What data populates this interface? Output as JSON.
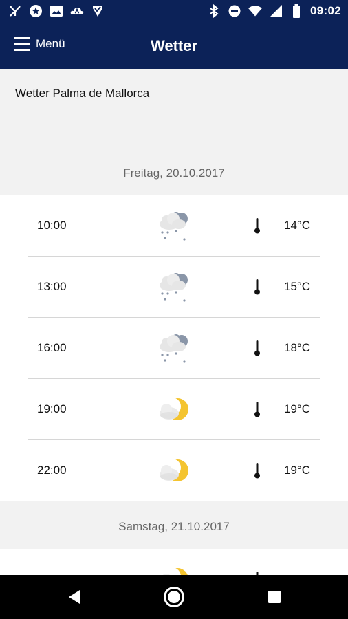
{
  "status_bar": {
    "time": "09:02",
    "left_icons": [
      "call-split-icon",
      "star-badge-icon",
      "image-icon",
      "cloud-a-icon",
      "shield-check-icon"
    ],
    "right_icons": [
      "bluetooth-icon",
      "do-not-disturb-icon",
      "wifi-icon",
      "signal-icon",
      "battery-icon"
    ]
  },
  "app_bar": {
    "menu_label": "Menü",
    "title": "Wetter"
  },
  "location": "Wetter Palma de Mallorca",
  "days": [
    {
      "date": "Freitag, 20.10.2017",
      "rows": [
        {
          "time": "10:00",
          "icon": "cloud-rain-icon",
          "temp": "14°C"
        },
        {
          "time": "13:00",
          "icon": "cloud-rain-icon",
          "temp": "15°C"
        },
        {
          "time": "16:00",
          "icon": "cloud-rain-icon",
          "temp": "18°C"
        },
        {
          "time": "19:00",
          "icon": "moon-cloud-icon",
          "temp": "19°C"
        },
        {
          "time": "22:00",
          "icon": "moon-cloud-icon",
          "temp": "19°C"
        }
      ]
    },
    {
      "date": "Samstag, 21.10.2017",
      "rows": [
        {
          "time": "",
          "icon": "moon-cloud-icon",
          "temp": ""
        }
      ]
    }
  ],
  "colors": {
    "header_bg": "#0c2258",
    "moon": "#f4c430",
    "cloud": "#e6e6e6",
    "rain_cloud": "#8a96a8"
  }
}
